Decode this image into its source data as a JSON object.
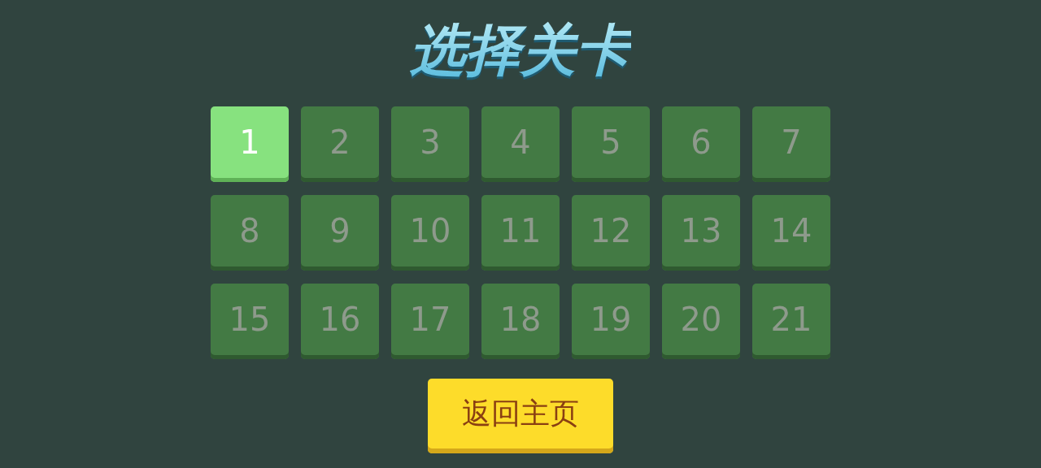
{
  "title": "选择关卡",
  "levels": [
    {
      "label": "1",
      "locked": false
    },
    {
      "label": "2",
      "locked": true
    },
    {
      "label": "3",
      "locked": true
    },
    {
      "label": "4",
      "locked": true
    },
    {
      "label": "5",
      "locked": true
    },
    {
      "label": "6",
      "locked": true
    },
    {
      "label": "7",
      "locked": true
    },
    {
      "label": "8",
      "locked": true
    },
    {
      "label": "9",
      "locked": true
    },
    {
      "label": "10",
      "locked": true
    },
    {
      "label": "11",
      "locked": true
    },
    {
      "label": "12",
      "locked": true
    },
    {
      "label": "13",
      "locked": true
    },
    {
      "label": "14",
      "locked": true
    },
    {
      "label": "15",
      "locked": true
    },
    {
      "label": "16",
      "locked": true
    },
    {
      "label": "17",
      "locked": true
    },
    {
      "label": "18",
      "locked": true
    },
    {
      "label": "19",
      "locked": true
    },
    {
      "label": "20",
      "locked": true
    },
    {
      "label": "21",
      "locked": true
    }
  ],
  "back_button": "返回主页"
}
